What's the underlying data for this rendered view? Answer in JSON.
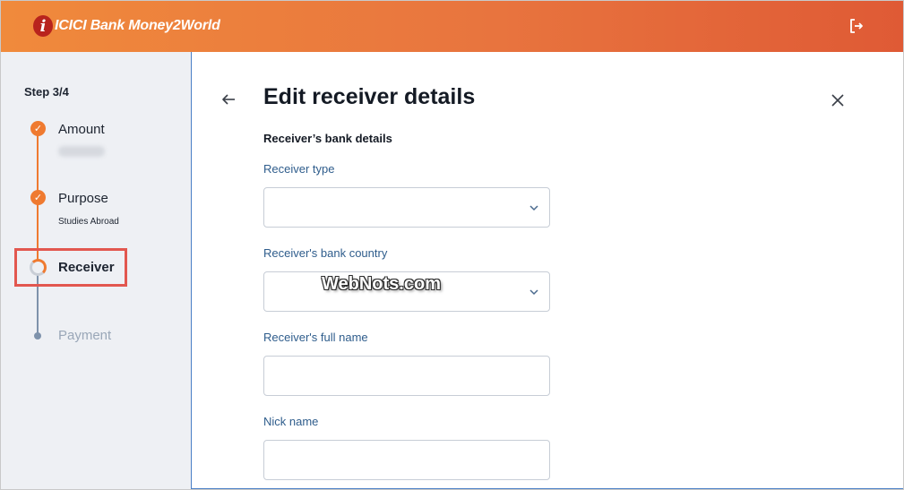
{
  "header": {
    "logo_mark": "i",
    "brand": "ICICI Bank Money2World",
    "logout_icon": "logout-icon"
  },
  "sidebar": {
    "step_count": "Step 3/4",
    "steps": [
      {
        "label": "Amount",
        "status": "done"
      },
      {
        "label": "Purpose",
        "sub": "Studies Abroad",
        "status": "done"
      },
      {
        "label": "Receiver",
        "status": "current"
      },
      {
        "label": "Payment",
        "status": "pending"
      }
    ]
  },
  "form": {
    "title": "Edit receiver details",
    "section": "Receiver’s bank details",
    "fields": [
      {
        "label": "Receiver type",
        "value": "",
        "type": "select"
      },
      {
        "label": "Receiver's bank country",
        "value": "",
        "type": "select"
      },
      {
        "label": "Receiver's full name",
        "value": "",
        "type": "text"
      },
      {
        "label": "Nick name",
        "value": "",
        "type": "text"
      }
    ]
  },
  "watermark": "WebNots.com",
  "colors": {
    "accent": "#ef7a30",
    "label_blue": "#2f5d8c",
    "highlight": "#e2574f"
  }
}
